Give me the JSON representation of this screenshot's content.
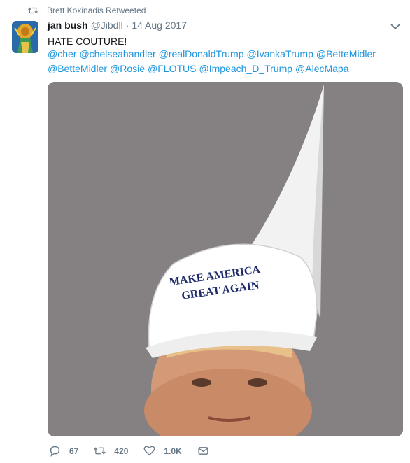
{
  "retweet_context": {
    "label": "Brett Kokinadis Retweeted",
    "icon": "retweet-icon"
  },
  "tweet": {
    "display_name": "jan bush",
    "handle": "@Jibdll",
    "separator": "·",
    "date": "14 Aug 2017",
    "text": "HATE COUTURE!",
    "mentions": [
      "@cher",
      "@chelseahandler",
      "@realDonaldTrump",
      "@IvankaTrump",
      "@BetteMidler",
      "@BetteMidler",
      "@Rosie",
      "@FLOTUS",
      "@Impeach_D_Trump",
      "@AlecMapa"
    ]
  },
  "image": {
    "cap_text_line1": "MAKE AMERICA",
    "cap_text_line2": "GREAT AGAIN",
    "background": "#858182"
  },
  "actions": {
    "reply_count": "67",
    "retweet_count": "420",
    "like_count": "1.0K"
  },
  "colors": {
    "link": "#1b95e0",
    "muted": "#657786",
    "text": "#14171a"
  }
}
